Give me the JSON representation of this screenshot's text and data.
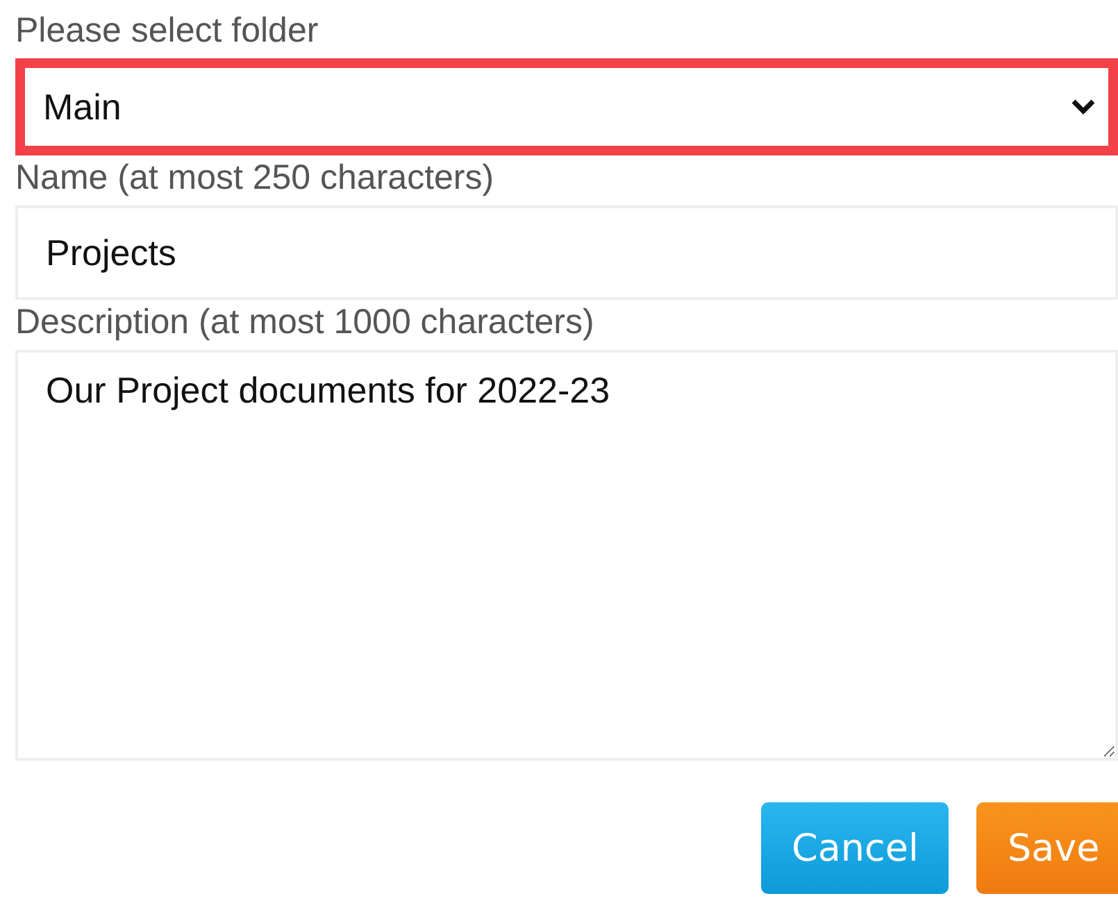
{
  "folder": {
    "label": "Please select folder",
    "value": "Main",
    "highlighted": true
  },
  "name": {
    "label": "Name (at most 250 characters)",
    "value": "Projects"
  },
  "description": {
    "label": "Description (at most 1000 characters)",
    "value": "Our Project documents for 2022-23"
  },
  "buttons": [
    {
      "label": "Cancel",
      "kind": "cancel"
    },
    {
      "label": "Save",
      "kind": "save"
    }
  ]
}
